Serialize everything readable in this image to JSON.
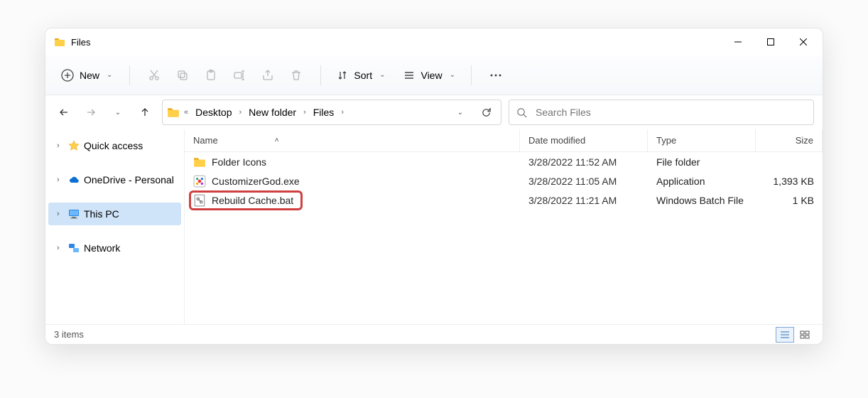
{
  "titlebar": {
    "title": "Files"
  },
  "toolbar": {
    "new_label": "New",
    "sort_label": "Sort",
    "view_label": "View"
  },
  "breadcrumbs": {
    "seg0": "Desktop",
    "seg1": "New folder",
    "seg2": "Files"
  },
  "search": {
    "placeholder": "Search Files"
  },
  "sidebar": {
    "items": [
      {
        "label": "Quick access"
      },
      {
        "label": "OneDrive - Personal"
      },
      {
        "label": "This PC"
      },
      {
        "label": "Network"
      }
    ]
  },
  "columns": {
    "name": "Name",
    "date": "Date modified",
    "type": "Type",
    "size": "Size"
  },
  "files": [
    {
      "name": "Folder Icons",
      "date": "3/28/2022 11:52 AM",
      "type": "File folder",
      "size": ""
    },
    {
      "name": "CustomizerGod.exe",
      "date": "3/28/2022 11:05 AM",
      "type": "Application",
      "size": "1,393 KB"
    },
    {
      "name": "Rebuild Cache.bat",
      "date": "3/28/2022 11:21 AM",
      "type": "Windows Batch File",
      "size": "1 KB"
    }
  ],
  "status": {
    "item_count": "3 items"
  },
  "colors": {
    "highlight": "#d14040",
    "selection": "#cfe4f8"
  }
}
